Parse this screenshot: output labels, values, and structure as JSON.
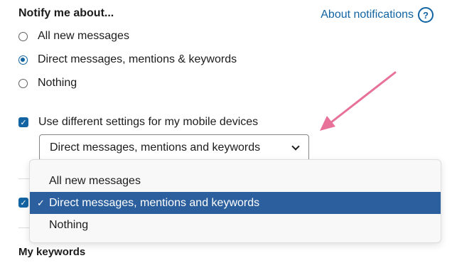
{
  "header": {
    "title": "Notify me about...",
    "help_link": "About notifications",
    "help_icon": "question-circle-icon"
  },
  "notify_options": [
    {
      "label": "All new messages",
      "checked": false
    },
    {
      "label": "Direct messages, mentions & keywords",
      "checked": true
    },
    {
      "label": "Nothing",
      "checked": false
    }
  ],
  "mobile": {
    "label": "Use different settings for my mobile devices",
    "checked": true,
    "select_value": "Direct messages, mentions and keywords"
  },
  "dropdown": {
    "options": [
      {
        "label": "All new messages",
        "selected": false
      },
      {
        "label": "Direct messages, mentions and keywords",
        "selected": true
      },
      {
        "label": "Nothing",
        "selected": false
      }
    ],
    "tick": "✓"
  },
  "keywords_title": "My keywords",
  "colors": {
    "accent": "#1264a3",
    "selected_row": "#2c5f9e",
    "arrow": "#e8719a"
  }
}
